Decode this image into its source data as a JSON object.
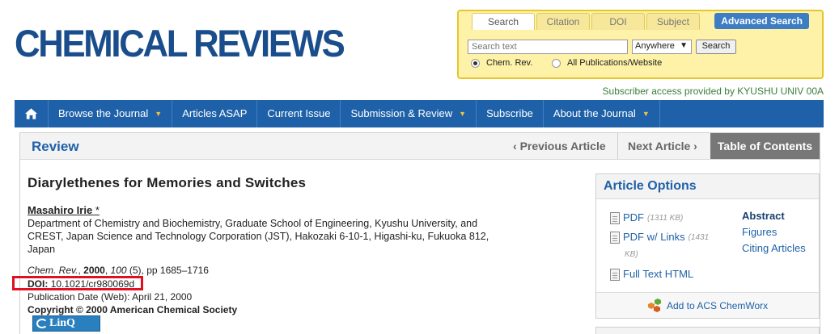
{
  "logo": {
    "text": "CHEMICAL REVIEWS"
  },
  "search": {
    "tabs": [
      "Search",
      "Citation",
      "DOI",
      "Subject"
    ],
    "active_tab": "Search",
    "advanced_label": "Advanced Search",
    "input_placeholder": "Search text",
    "scope_selected": "Anywhere",
    "button_label": "Search",
    "radio_options": [
      "Chem. Rev.",
      "All Publications/Website"
    ],
    "radio_selected": "Chem. Rev."
  },
  "subscriber_text": "Subscriber access provided by KYUSHU UNIV 00A",
  "nav": {
    "home_icon": "home-icon",
    "items": [
      {
        "label": "Browse the Journal",
        "dropdown": true
      },
      {
        "label": "Articles ASAP",
        "dropdown": false
      },
      {
        "label": "Current Issue",
        "dropdown": false
      },
      {
        "label": "Submission & Review",
        "dropdown": true
      },
      {
        "label": "Subscribe",
        "dropdown": false
      },
      {
        "label": "About the Journal",
        "dropdown": true
      }
    ]
  },
  "subnav": {
    "section": "Review",
    "prev": "Previous Article",
    "next": "Next Article",
    "toc": "Table of Contents"
  },
  "article": {
    "title": "Diarylethenes for Memories and Switches",
    "author": "Masahiro Irie",
    "author_mark": "*",
    "affiliation": "Department of Chemistry and Biochemistry, Graduate School of Engineering, Kyushu University, and CREST, Japan Science and Technology Corporation (JST), Hakozaki 6-10-1, Higashi-ku, Fukuoka 812, Japan",
    "citation": {
      "journal": "Chem. Rev.",
      "sep1": ", ",
      "year": "2000",
      "sep2": ", ",
      "volume": "100",
      "rest": " (5), pp 1685–1716"
    },
    "doi_label": "DOI:",
    "doi_value": "10.1021/cr980069d",
    "pubdate": "Publication Date (Web): April 21, 2000",
    "copyright": "Copyright © 2000 American Chemical Society",
    "linq_label": "LinQ"
  },
  "options": {
    "header": "Article Options",
    "pdf_label": "PDF",
    "pdf_size": "(1311 KB)",
    "pdf_links_label": "PDF w/ Links",
    "pdf_links_size_a": "(1431",
    "pdf_links_size_b": "KB)",
    "fulltext_label": "Full Text HTML",
    "side_links": [
      "Abstract",
      "Figures",
      "Citing Articles"
    ],
    "chemworx_label": "Add to ACS ChemWorx"
  },
  "colors": {
    "brand": "#1f61a8",
    "highlight": "#e01020",
    "search_bg": "#fdf2a8"
  }
}
